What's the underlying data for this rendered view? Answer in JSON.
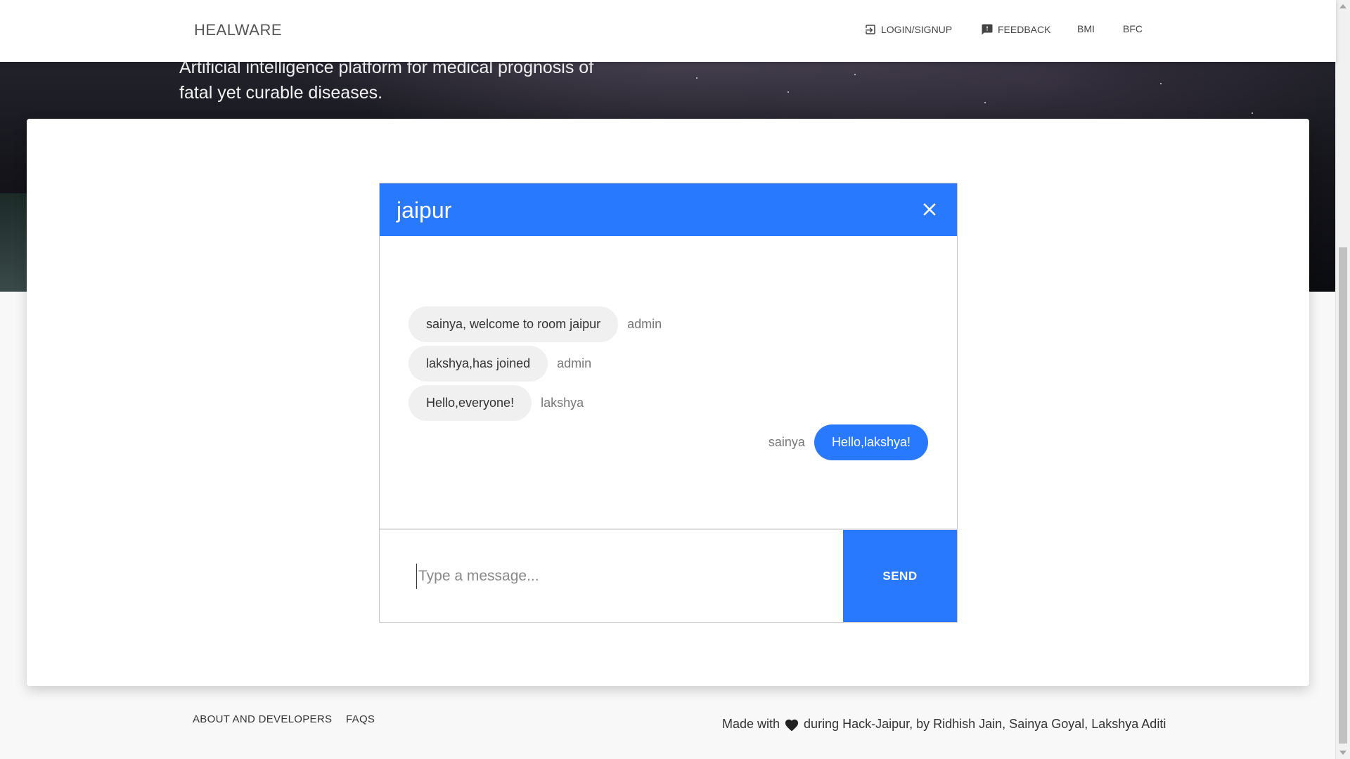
{
  "navbar": {
    "brand": "HEALWARE",
    "items": [
      {
        "label": "LOGIN/SIGNUP",
        "icon": "login-icon"
      },
      {
        "label": "FEEDBACK",
        "icon": "feedback-icon"
      },
      {
        "label": "BMI"
      },
      {
        "label": "BFC"
      }
    ]
  },
  "hero": {
    "tagline": "Artificial intelligence platform for medical prognosis of fatal yet curable diseases."
  },
  "chat": {
    "room": "jaipur",
    "close_icon": "close-icon",
    "messages": [
      {
        "text": "sainya, welcome to room jaipur",
        "sender": "admin",
        "mine": false
      },
      {
        "text": "lakshya,has joined",
        "sender": "admin",
        "mine": false
      },
      {
        "text": "Hello,everyone!",
        "sender": "lakshya",
        "mine": false
      },
      {
        "text": "Hello,lakshya!",
        "sender": "sainya",
        "mine": true
      }
    ],
    "input_placeholder": "Type a message...",
    "input_value": "",
    "send_label": "SEND"
  },
  "footer": {
    "links": [
      "ABOUT AND DEVELOPERS",
      "FAQS"
    ],
    "credits_prefix": "Made with",
    "credits_icon": "heart-icon",
    "credits_suffix": "during Hack-Jaipur, by Ridhish Jain, Sainya Goyal, Lakshya Aditi"
  },
  "colors": {
    "accent": "#2979ff",
    "bubble_other": "#f0f0f0"
  }
}
